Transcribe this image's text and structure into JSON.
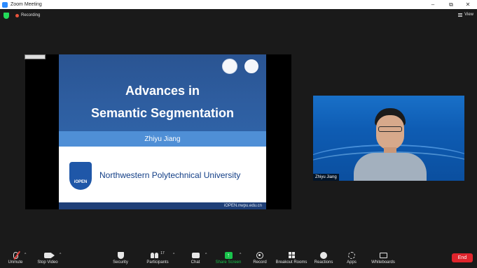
{
  "window": {
    "title": "Zoom Meeting",
    "minimize": "–",
    "maximize": "⧉",
    "close": "✕"
  },
  "meeting_bar": {
    "recording_label": "Recording",
    "view_label": "View"
  },
  "slide": {
    "title_line1": "Advances in",
    "title_line2": "Semantic Segmentation",
    "author": "Zhiyu Jiang",
    "logo_text": "iOPEN",
    "university": "Northwestern Polytechnical University",
    "url": "iOPEN.nwpu.edu.cn"
  },
  "video": {
    "participant_name": "Zhiyu Jiang"
  },
  "toolbar": {
    "unmute": "Unmute",
    "stop_video": "Stop Video",
    "security": "Security",
    "participants": "Participants",
    "participants_count": "17",
    "chat": "Chat",
    "share_screen": "Share Screen",
    "record": "Record",
    "breakout_rooms": "Breakout Rooms",
    "reactions": "Reactions",
    "apps": "Apps",
    "whiteboards": "Whiteboards",
    "end": "End"
  },
  "colors": {
    "share_green": "#19c34c",
    "end_red": "#e0242c",
    "slide_blue": "#2e5d9f",
    "band_blue": "#4f8fd6"
  }
}
